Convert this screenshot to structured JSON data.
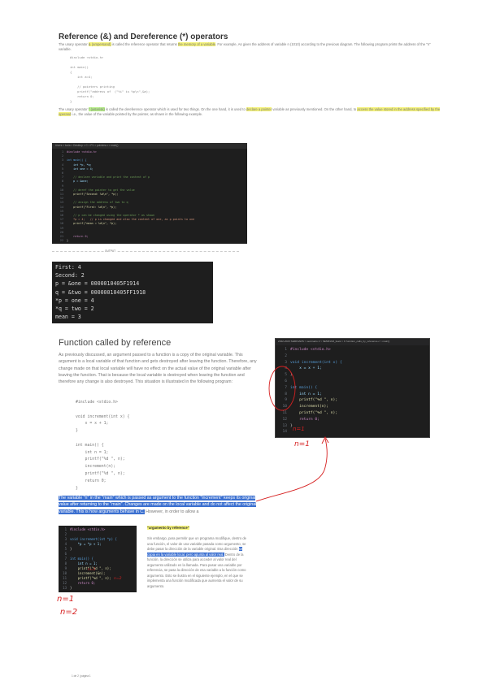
{
  "section1": {
    "title": "Reference (&) and Dereference (*) operators",
    "para1_a": "The unary operator",
    "para1_hl1": "& (ampersand)",
    "para1_b": "is called the reference operator that returns",
    "para1_hl2": "the memory of a variable",
    "para1_c": ". For example, As given the address of variable n (1010) according to the previous diagram. The following program prints the address of the \"n\" variable.",
    "code": [
      "#include <stdio.h>",
      "",
      "int main()",
      "{",
      "    int a=4;",
      "",
      "    // pointers printing",
      "    printf(\"address of  (\"%i\" is %p\\n\",&a);",
      "    return 0;",
      "}"
    ],
    "para2_a": "The unary operator",
    "para2_hl1": "* (asterisk)",
    "para2_b": "is called the dereference operator which is used for two things. On the one hand, it is used to",
    "para2_hl2": "declare a pointer",
    "para2_c": "variable as previously mentioned. On the other hand, to",
    "para2_hl3": "access the value stored in the address specified by the operand",
    "para2_d": "i.e., the value of the variable pointed by the pointer, as shown in the following example."
  },
  "editor1": {
    "header": "Users > lucia > Desktop > C > P1 > pointers.c > main()",
    "lines": [
      {
        "n": "1",
        "t": "#include <stdio.h>",
        "c": "#c586c0"
      },
      {
        "n": "2",
        "t": "",
        "c": "#ccc"
      },
      {
        "n": "3",
        "t": "int main() {",
        "c": "#569cd6"
      },
      {
        "n": "4",
        "t": "    int *p, *q;",
        "c": "#9cdcfe"
      },
      {
        "n": "5",
        "t": "    int one = 4;",
        "c": "#9cdcfe"
      },
      {
        "n": "6",
        "t": "",
        "c": "#ccc"
      },
      {
        "n": "7",
        "t": "    // declare variable and print the content of p",
        "c": "#6a9955"
      },
      {
        "n": "8",
        "t": "    p = &one;",
        "c": "#9cdcfe"
      },
      {
        "n": "9",
        "t": "",
        "c": "#ccc"
      },
      {
        "n": "10",
        "t": "    // deref the pointer to get the value",
        "c": "#6a9955"
      },
      {
        "n": "11",
        "t": "    printf(\"Second: %d\\n\", *p);",
        "c": "#dcdcaa"
      },
      {
        "n": "12",
        "t": "",
        "c": "#ccc"
      },
      {
        "n": "13",
        "t": "    // assign the address of two to q",
        "c": "#6a9955"
      },
      {
        "n": "14",
        "t": "    printf(\"First: %d\\n\", *p);",
        "c": "#dcdcaa"
      },
      {
        "n": "15",
        "t": "",
        "c": "#ccc"
      },
      {
        "n": "16",
        "t": "    // p can be changed using the operator * as shown",
        "c": "#6a9955"
      },
      {
        "n": "17",
        "t": "    *p = 4;   // p is changed and also the content of one, as p points to one",
        "c": "#ce9178"
      },
      {
        "n": "18",
        "t": "    printf(\"mean = %d\\n\", *p);",
        "c": "#dcdcaa"
      },
      {
        "n": "19",
        "t": "",
        "c": "#ccc"
      },
      {
        "n": "20",
        "t": "",
        "c": "#ccc"
      },
      {
        "n": "21",
        "t": "    return 0;",
        "c": "#c586c0"
      },
      {
        "n": "22",
        "t": "}",
        "c": "#ccc"
      }
    ]
  },
  "caption1": "OUTPUT",
  "terminal": [
    "First: 4",
    "Second: 2",
    "p = &one = 0000010405F1914",
    "q = &two = 00000010405FF1918",
    "*p = one = 4",
    "*q = two = 2",
    "mean = 3"
  ],
  "section2": {
    "title": "Function called by reference",
    "para": "As previously discussed, an argument passed to a function is a copy of the original variable. This argument is a local variable of that function and gets destroyed after leaving the function. Therefore, any change made on that local variable will have no effect on the actual value of the original variable after leaving the function. That is because the local variable is destroyed when leaving the function and therefore any change is also destroyed. This situation is illustrated in the following program:",
    "code": [
      "#include <stdio.h>",
      "",
      "void increment(int x) {",
      "    x = x + 1;",
      "}",
      "",
      "int main() {",
      "    int n = 1;",
      "    printf(\"%d \", n);",
      "    increment(n);",
      "    printf(\"%d \", n);",
      "    return 0;",
      "}"
    ],
    "blue_text": "The variable \"n\" in the \"main\" which is passed as argument to the function \"increment\" keeps its original value after returning to the \"main\". Changes are made on the local variable and do not affect the original variable. This is how arguments behave in C.",
    "after_blue": "However, in order to allow a"
  },
  "editor2": {
    "header": "2022-2023 SEMINARS > seminario 2 > SEMINAR_feats > C function_calls_by_reference.c > main()",
    "lines": [
      {
        "n": "1",
        "t": "#include <stdio.h>",
        "c": "#c586c0"
      },
      {
        "n": "2",
        "t": "",
        "c": "#ccc"
      },
      {
        "n": "3",
        "t": "void increment(int x) {",
        "c": "#569cd6"
      },
      {
        "n": "4",
        "t": "    x = x + 1;",
        "c": "#9cdcfe"
      },
      {
        "n": "5",
        "t": "}",
        "c": "#ccc"
      },
      {
        "n": "6",
        "t": "",
        "c": "#ccc"
      },
      {
        "n": "7",
        "t": "int main() {",
        "c": "#569cd6"
      },
      {
        "n": "8",
        "t": "    int n = 1;",
        "c": "#9cdcfe"
      },
      {
        "n": "9",
        "t": "    printf(\"%d \", n);",
        "c": "#dcdcaa"
      },
      {
        "n": "10",
        "t": "    increment(n);",
        "c": "#dcdcaa"
      },
      {
        "n": "11",
        "t": "    printf(\"%d \", n);",
        "c": "#dcdcaa"
      },
      {
        "n": "12",
        "t": "    return 0;",
        "c": "#c586c0"
      },
      {
        "n": "13",
        "t": "}",
        "c": "#ccc"
      },
      {
        "n": "14",
        "t": "",
        "c": "#ccc"
      }
    ]
  },
  "annotations": {
    "ed2_label": "n=1",
    "ed2_under": "n=1",
    "ed3_a": "n=1",
    "ed3_b": "n=2",
    "ed3_side1": "n=1",
    "ed3_side2": "n=2"
  },
  "editor3": {
    "lines": [
      {
        "n": "1",
        "t": "#include <stdio.h>",
        "c": "#c586c0"
      },
      {
        "n": "2",
        "t": "",
        "c": "#ccc"
      },
      {
        "n": "3",
        "t": "void increment(int *p) {",
        "c": "#569cd6"
      },
      {
        "n": "4",
        "t": "    *p = *p + 1;",
        "c": "#9cdcfe"
      },
      {
        "n": "5",
        "t": "}",
        "c": "#ccc"
      },
      {
        "n": "6",
        "t": "",
        "c": "#ccc"
      },
      {
        "n": "7",
        "t": "int main() {",
        "c": "#569cd6"
      },
      {
        "n": "8",
        "t": "    int n = 1;",
        "c": "#9cdcfe"
      },
      {
        "n": "9",
        "t": "    printf(\"%d \", n);",
        "c": "#dcdcaa"
      },
      {
        "n": "10",
        "t": "    increment(&n);",
        "c": "#dcdcaa"
      },
      {
        "n": "11",
        "t": "    printf(\"%d \", n);",
        "c": "#dcdcaa"
      },
      {
        "n": "12",
        "t": "    return 0;",
        "c": "#c586c0"
      },
      {
        "n": "13",
        "t": "}",
        "c": "#ccc"
      }
    ]
  },
  "spanish": {
    "heading": "\"argumento by reference\"",
    "para_a": "Sin embargo, para permitir que un programa modifique, dentro de una función, el valor de una variable pasada como argumento, se debe pasar la dirección de la variable original. Esa dirección",
    "para_hl": "se copia en la variable local, pero apunta al valor real.",
    "para_b": "Dentro de la función, la dirección se utiliza para acceder al valor real del argumento utilizado en la llamada. Para pasar una variable por referencia, se pasa la dirección de esa variable a la función como argumento. Esto se ilustra en el siguiente ejemplo, en el que se implementa una función modificada que aumenta el valor de su argumento."
  },
  "footer": "1 de 2 | página 1"
}
